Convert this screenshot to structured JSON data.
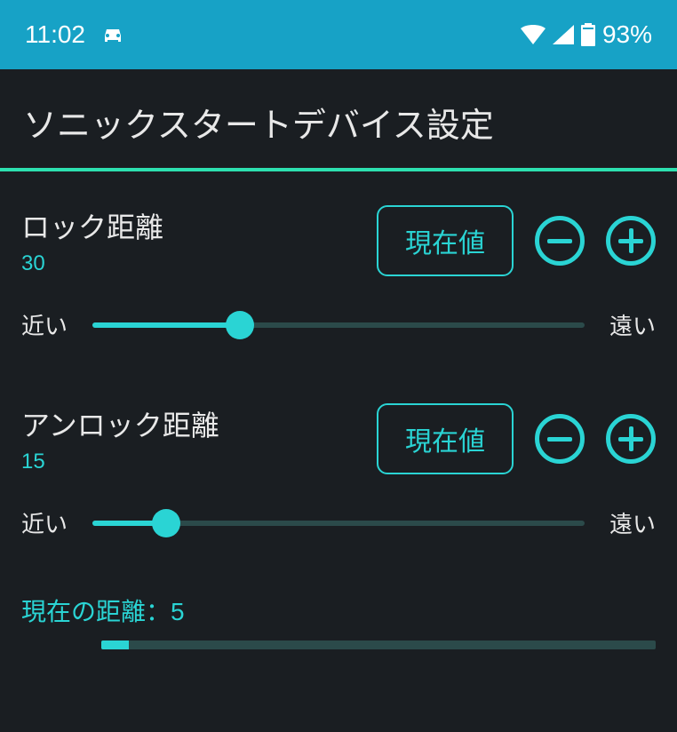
{
  "status": {
    "time": "11:02",
    "battery": "93%"
  },
  "title": "ソニックスタートデバイス設定",
  "lock": {
    "label": "ロック距離",
    "value": "30",
    "current_btn": "現在値",
    "near": "近い",
    "far": "遠い",
    "slider_percent": 30
  },
  "unlock": {
    "label": "アンロック距離",
    "value": "15",
    "current_btn": "現在値",
    "near": "近い",
    "far": "遠い",
    "slider_percent": 15
  },
  "current": {
    "label": "現在の距離：5",
    "percent": 5
  },
  "colors": {
    "accent": "#2ad4d4",
    "statusbar": "#17a2c6",
    "bg": "#1a1e22"
  }
}
